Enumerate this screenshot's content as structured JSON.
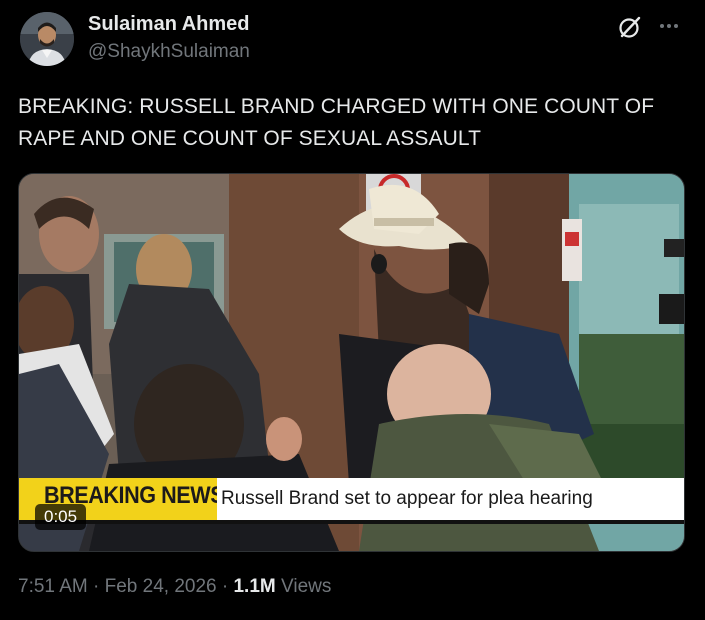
{
  "author": {
    "name": "Sulaiman Ahmed",
    "handle": "@ShaykhSulaiman"
  },
  "icons": {
    "grok": "grok-icon",
    "more": "more-options-icon"
  },
  "tweet": {
    "text": "BREAKING: RUSSELL BRAND CHARGED WITH ONE COUNT OF RAPE AND ONE COUNT OF SEXUAL ASSAULT"
  },
  "media": {
    "banner_title": "BREAKING NEWS",
    "banner_caption": "Russell Brand set to appear for plea hearing",
    "duration": "0:05"
  },
  "meta": {
    "time": "7:51 AM",
    "separator": "·",
    "date": "Feb 24, 2026",
    "views_count": "1.1M",
    "views_label": "Views"
  }
}
